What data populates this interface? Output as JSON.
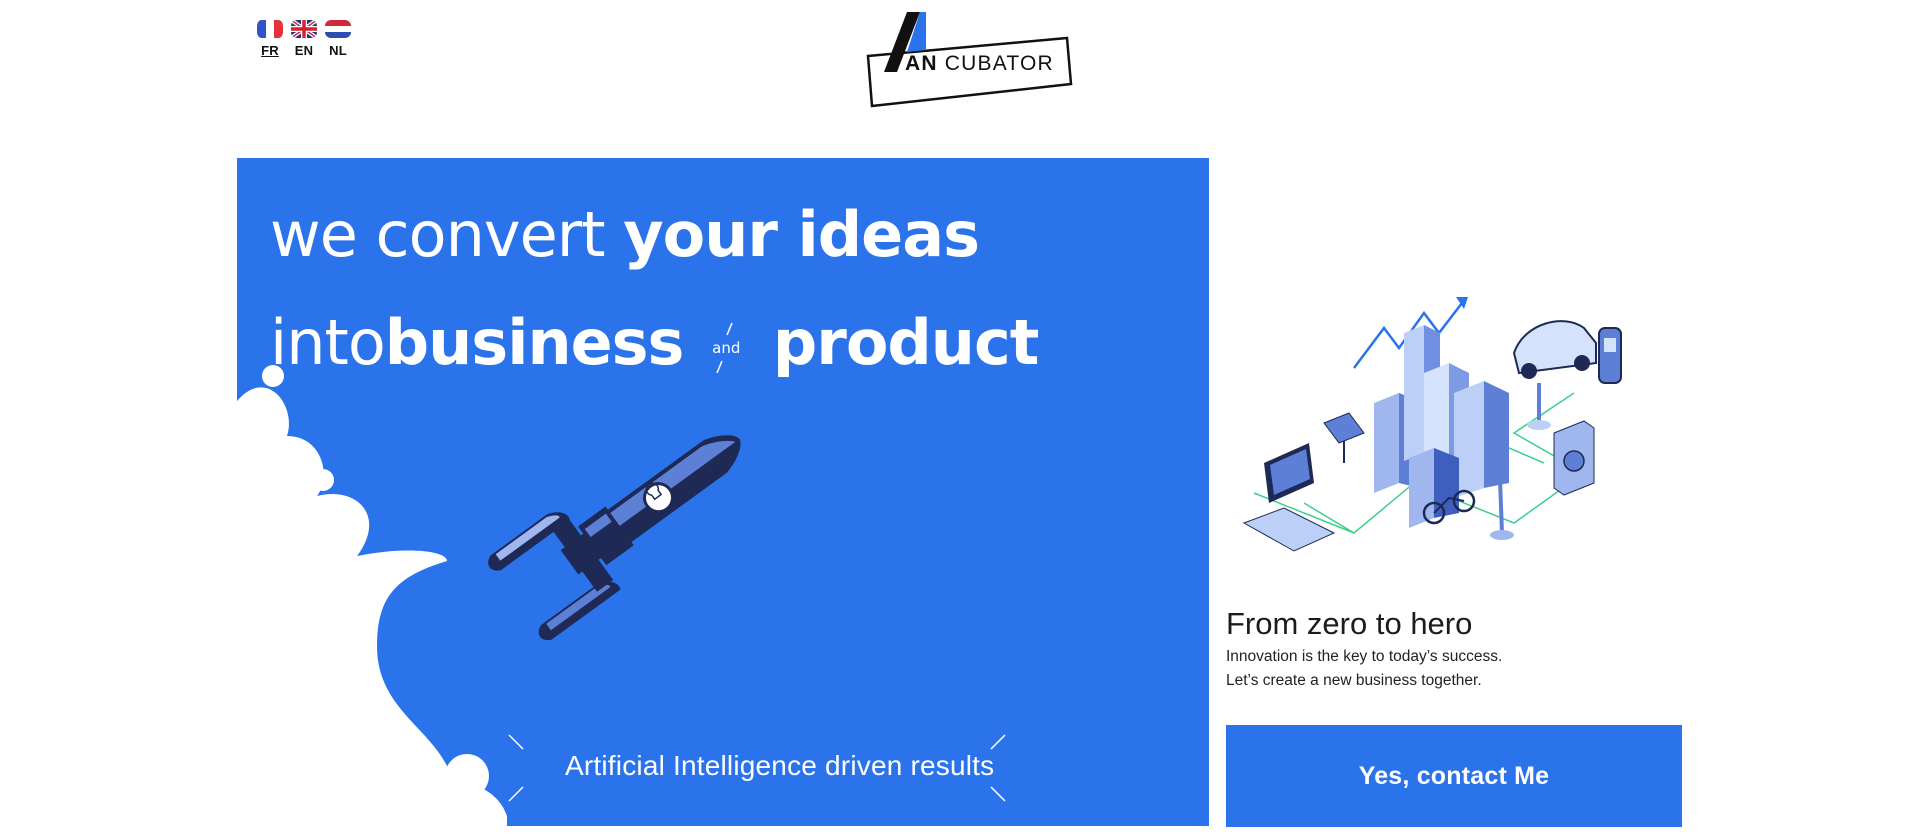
{
  "languages": [
    {
      "code": "FR",
      "flag": "france-flag",
      "active": true
    },
    {
      "code": "EN",
      "flag": "uk-flag",
      "active": false
    },
    {
      "code": "NL",
      "flag": "netherlands-flag",
      "active": false
    }
  ],
  "logo": {
    "bold_text": "AN",
    "text": "CUBATOR",
    "accent_color": "#2a73eb"
  },
  "hero": {
    "line1_light": "we convert",
    "line1_bold": "your ideas",
    "line2_light": "into",
    "line2_bold_a": "business",
    "connector": "and",
    "line2_bold_b": "product",
    "tagline": "Artificial Intelligence driven results",
    "background_color": "#2a73eb"
  },
  "side": {
    "title": "From zero to hero",
    "line1": "Innovation is the key to today’s success.",
    "line2": "Let’s create a new business together.",
    "cta_label": "Yes, contact Me"
  },
  "colors": {
    "brand_blue": "#2a73eb",
    "navy": "#1e2a55",
    "text": "#1c1c1c"
  }
}
